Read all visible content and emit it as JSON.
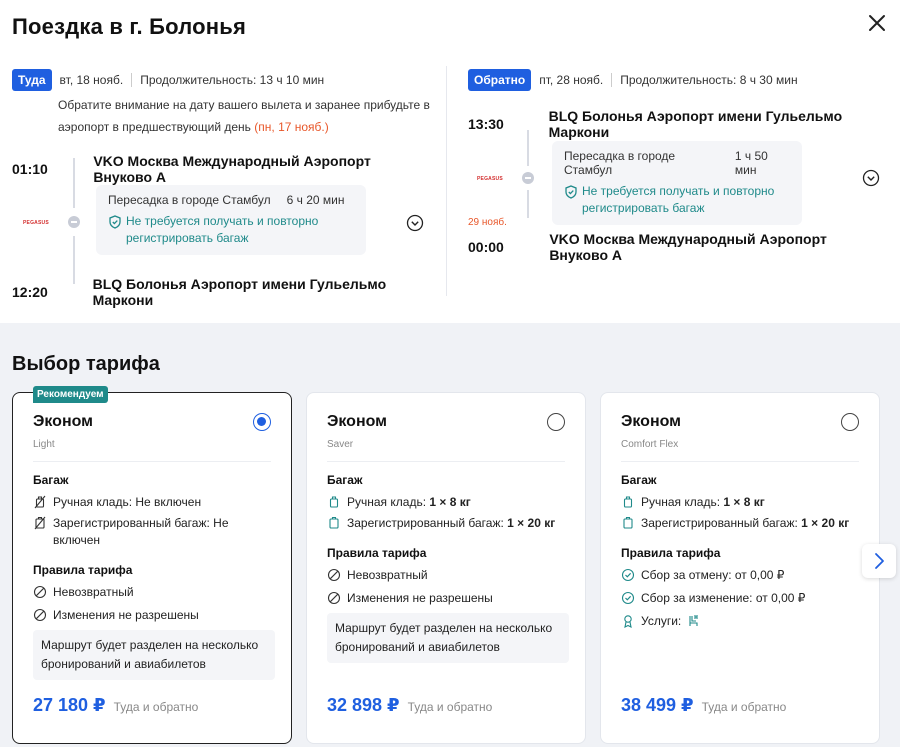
{
  "header": {
    "title": "Поездка в г. Болонья"
  },
  "outbound": {
    "badge": "Туда",
    "date": "вт, 18 нояб.",
    "duration": "Продолжительность: 13 ч 10 мин",
    "notice": "Обратите внимание на дату вашего вылета и заранее прибудьте в аэропорт в предшествующий день",
    "notice_date": "(пн, 17 нояб.)",
    "dep_time": "01:10",
    "dep_place": "VKO Москва Международный Аэропорт Внуково А",
    "transfer_city": "Пересадка в городе Стамбул",
    "transfer_time": "6 ч 20 мин",
    "transfer_note": "Не требуется получать и повторно регистрировать багаж",
    "airline": "PEGASUS",
    "arr_time": "12:20",
    "arr_place": "BLQ Болонья Аэропорт имени Гульельмо Маркони"
  },
  "return": {
    "badge": "Обратно",
    "date": "пт, 28 нояб.",
    "duration": "Продолжительность: 8 ч 30 мин",
    "dep_time": "13:30",
    "dep_place": "BLQ Болонья Аэропорт имени Гульельмо Маркони",
    "transfer_city": "Пересадка в городе Стамбул",
    "transfer_time": "1 ч 50 мин",
    "transfer_note": "Не требуется получать и повторно регистрировать багаж",
    "airline": "PEGASUS",
    "arr_date": "29 нояб.",
    "arr_time": "00:00",
    "arr_place": "VKO Москва Международный Аэропорт Внуково А"
  },
  "fares": {
    "title": "Выбор тарифа",
    "cards": [
      {
        "tag": "Рекомендуем",
        "name": "Эконом",
        "sub": "Light",
        "baggage_title": "Багаж",
        "hand_label": "Ручная кладь: Не включен",
        "checked_label": "Зарегистрированный багаж: Не включен",
        "rules_title": "Правила тарифа",
        "rule1": "Невозвратный",
        "rule2": "Изменения не разрешены",
        "note": "Маршрут будет разделен на несколько бронирований и авиабилетов",
        "price": "27 180 ₽",
        "price_sub": "Туда и обратно"
      },
      {
        "name": "Эконом",
        "sub": "Saver",
        "baggage_title": "Багаж",
        "hand_label": "Ручная кладь:",
        "hand_value": "1 × 8 кг",
        "checked_label": "Зарегистрированный багаж:",
        "checked_value": "1 × 20 кг",
        "rules_title": "Правила тарифа",
        "rule1": "Невозвратный",
        "rule2": "Изменения не разрешены",
        "note": "Маршрут будет разделен на несколько бронирований и авиабилетов",
        "price": "32 898 ₽",
        "price_sub": "Туда и обратно"
      },
      {
        "name": "Эконом",
        "sub": "Comfort Flex",
        "baggage_title": "Багаж",
        "hand_label": "Ручная кладь:",
        "hand_value": "1 × 8 кг",
        "checked_label": "Зарегистрированный багаж:",
        "checked_value": "1 × 20 кг",
        "rules_title": "Правила тарифа",
        "rule1": "Сбор за отмену: от 0,00 ₽",
        "rule2": "Сбор за изменение: от 0,00 ₽",
        "rule3": "Услуги:",
        "price": "38 499 ₽",
        "price_sub": "Туда и обратно"
      }
    ]
  }
}
